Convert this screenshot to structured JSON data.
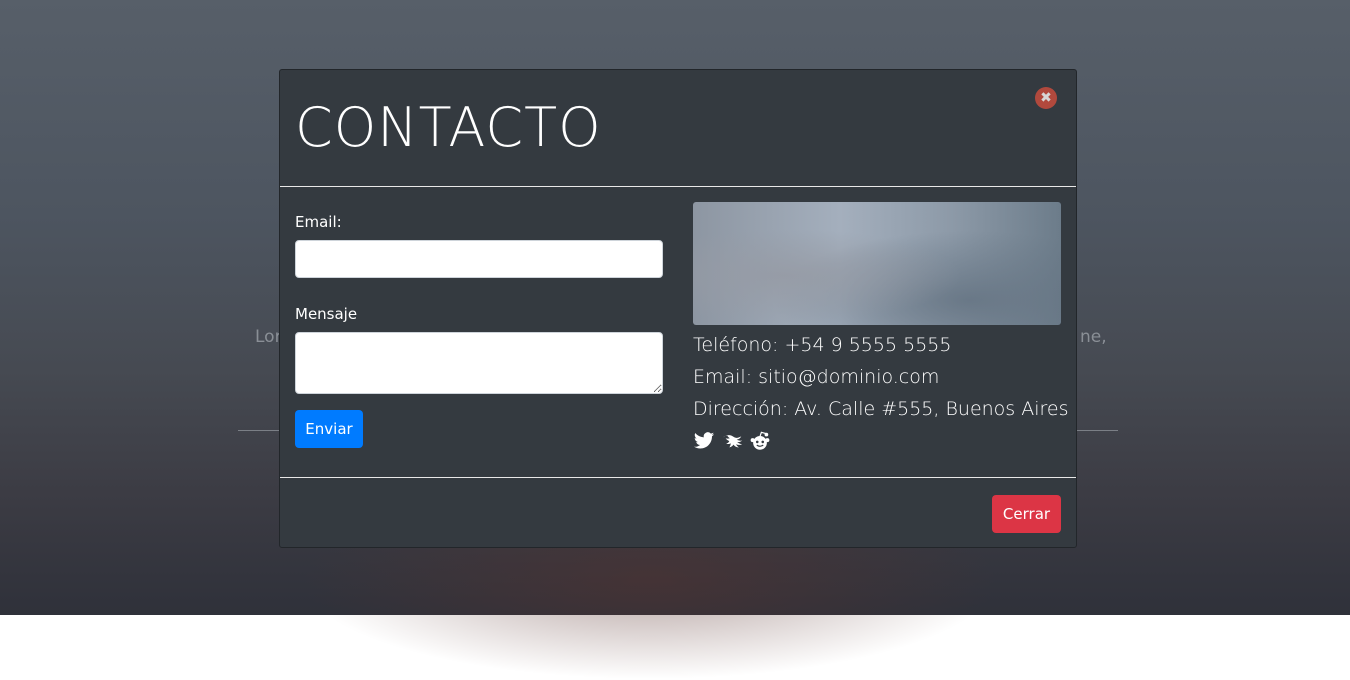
{
  "background": {
    "text_left": "Lor",
    "text_right": "ne,"
  },
  "modal": {
    "title": "CONTACTO",
    "close_icon": "close-circle-icon",
    "form": {
      "email_label": "Email:",
      "email_value": "",
      "message_label": "Mensaje",
      "message_value": "",
      "submit_label": "Enviar"
    },
    "info": {
      "phone": "Teléfono: +54 9 5555 5555",
      "email": "Email: sitio@dominio.com",
      "address": "Dirección: Av. Calle #555, Buenos Aires",
      "social_icons": [
        "twitter-icon",
        "kraken-icon",
        "reddit-icon"
      ]
    },
    "footer": {
      "close_label": "Cerrar"
    }
  },
  "colors": {
    "modal_bg": "#343a40",
    "primary": "#007bff",
    "danger": "#dc3545",
    "close_icon_bg": "#b1493d"
  }
}
